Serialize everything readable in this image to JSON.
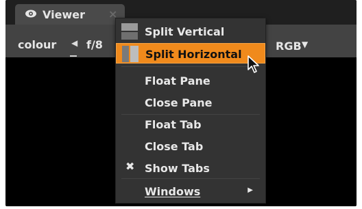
{
  "tab": {
    "title": "Viewer",
    "close": "×"
  },
  "toolbar": {
    "channel": "colour",
    "fstop": "f/8",
    "mode": "RGB"
  },
  "menu": {
    "items": [
      {
        "label": "Split Vertical"
      },
      {
        "label": "Split Horizontal",
        "selected": true
      },
      {
        "label": "Float Pane"
      },
      {
        "label": "Close Pane"
      },
      {
        "label": "Float Tab"
      },
      {
        "label": "Close Tab"
      },
      {
        "label": "Show Tabs",
        "checked": true
      },
      {
        "label": "Windows",
        "has_submenu": true
      }
    ]
  },
  "colors": {
    "highlight": "#f08a1c",
    "menu_bg": "#333333",
    "toolbar_bg": "#434343"
  }
}
